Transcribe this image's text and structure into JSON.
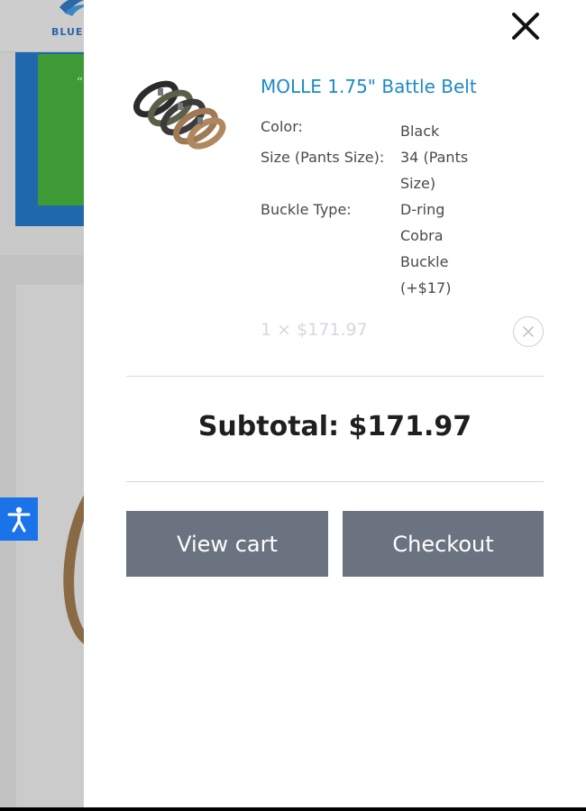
{
  "background": {
    "logo_text": "BLUE",
    "quote_mark": "“"
  },
  "drawer": {
    "item": {
      "title": "MOLLE 1.75\" Battle Belt",
      "variations": [
        {
          "label": "Color:",
          "value": "Black"
        },
        {
          "label": "Size (Pants Size):",
          "value": "34 (Pants Size)"
        },
        {
          "label": "Buckle Type:",
          "value": "D-ring Cobra Buckle (+$17)"
        }
      ],
      "quantity_price": "1 × $171.97"
    },
    "subtotal": "Subtotal: $171.97",
    "buttons": {
      "view_cart": "View cart",
      "checkout": "Checkout"
    }
  },
  "icons": {
    "close": "close-icon",
    "remove": "remove-item-icon",
    "accessibility": "accessibility-icon"
  },
  "colors": {
    "title_blue": "#1e8ac4",
    "button_gray": "#6b7380",
    "accessibility_blue": "#1a73e8"
  }
}
